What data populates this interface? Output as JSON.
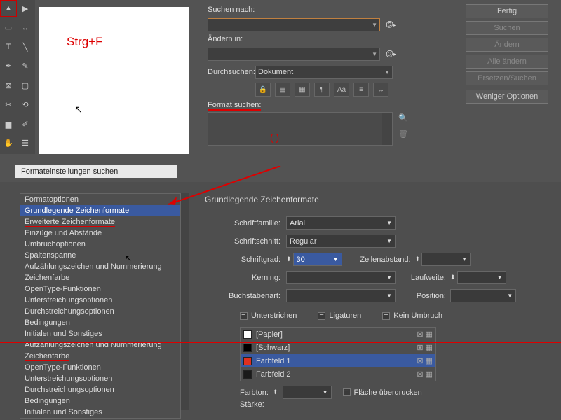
{
  "toolbar": {
    "tools": [
      "move",
      "direct",
      "page",
      "gap",
      "type",
      "pen",
      "pencil",
      "line",
      "rect",
      "scissors",
      "rotate",
      "grad",
      "eyedrop",
      "hand",
      "zoom",
      "note"
    ]
  },
  "overlay": {
    "shortcut": "Strg+F",
    "parentheses": "(  )"
  },
  "search": {
    "search_label": "Suchen nach:",
    "search_value": "",
    "change_label": "Ändern in:",
    "change_value": "",
    "scope_label": "Durchsuchen:",
    "scope_value": "Dokument",
    "format_label": "Format suchen:",
    "at_symbol": "@",
    "buttons": {
      "done": "Fertig",
      "search": "Suchen",
      "change": "Ändern",
      "change_all": "Alle ändern",
      "replace_search": "Ersetzen/Suchen",
      "less": "Weniger Optionen"
    },
    "icons": [
      "lock",
      "book",
      "layer",
      "para",
      "Aa",
      "style",
      "dir"
    ]
  },
  "dlg2": {
    "title": "Formateinstellungen suchen",
    "categories": [
      "Formatoptionen",
      "Grundlegende Zeichenformate",
      "Erweiterte Zeichenformate",
      "Einzüge und Abstände",
      "Umbruchoptionen",
      "Spaltenspanne",
      "Aufzählungszeichen und Nummerierung",
      "Zeichenfarbe",
      "OpenType-Funktionen",
      "Unterstreichungsoptionen",
      "Durchstreichungsoptionen",
      "Bedingungen",
      "Initialen und Sonstiges",
      "Aufzählungszeichen und Nummerierung",
      "Zeichenfarbe",
      "OpenType-Funktionen",
      "Unterstreichungsoptionen",
      "Durchstreichungsoptionen",
      "Bedingungen",
      "Initialen und Sonstiges"
    ],
    "selected_index": 1,
    "red_indices": [
      2,
      14
    ],
    "panel_title": "Grundlegende Zeichenformate",
    "fields": {
      "family_lbl": "Schriftfamilie:",
      "family_val": "Arial",
      "style_lbl": "Schriftschnitt:",
      "style_val": "Regular",
      "size_lbl": "Schriftgrad:",
      "size_val": "30",
      "leading_lbl": "Zeilenabstand:",
      "leading_val": "",
      "kerning_lbl": "Kerning:",
      "kerning_val": "",
      "tracking_lbl": "Laufweite:",
      "tracking_val": "",
      "case_lbl": "Buchstabenart:",
      "case_val": "",
      "position_lbl": "Position:",
      "position_val": ""
    },
    "checks": {
      "underline": "Unterstrichen",
      "ligatures": "Ligaturen",
      "nobreak": "Kein Umbruch"
    },
    "swatches": [
      {
        "name": "[Papier]",
        "color": "#fff"
      },
      {
        "name": "[Schwarz]",
        "color": "#000"
      },
      {
        "name": "Farbfeld 1",
        "color": "#e03020"
      },
      {
        "name": "Farbfeld 2",
        "color": "#1a1a1a"
      }
    ],
    "swatch_selected": 2,
    "tint_lbl": "Farbton:",
    "tint_val": "",
    "overprint_lbl": "Fläche überdrucken",
    "stroke_lbl": "Stärke:"
  }
}
